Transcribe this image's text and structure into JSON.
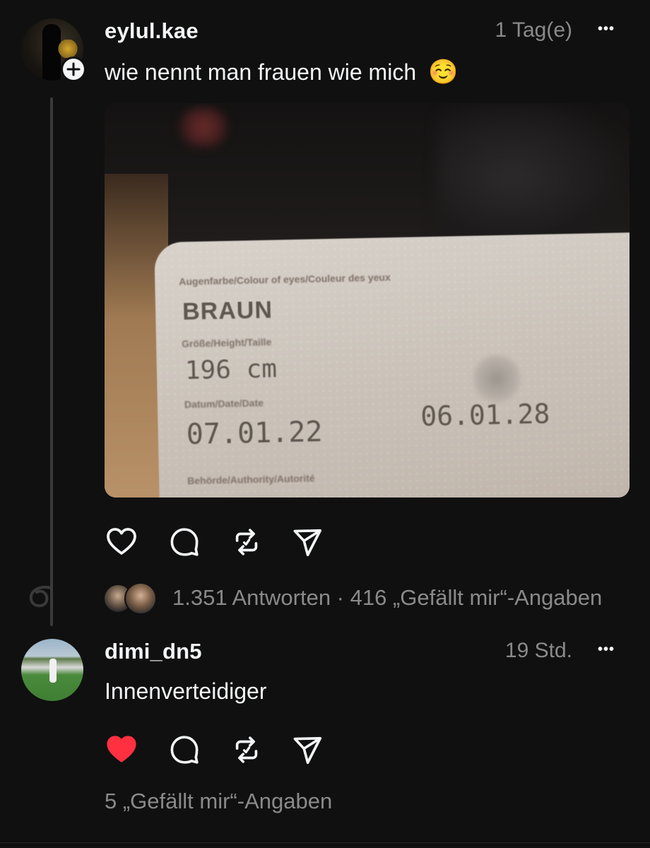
{
  "post": {
    "username": "eylul.kae",
    "time": "1 Tag(e)",
    "more": "•••",
    "text": "wie nennt man frauen wie mich",
    "emoji": "☺️",
    "image": {
      "eye_label": "Augenfarbe/Colour of eyes/Couleur des yeux",
      "eye_value": "BRAUN",
      "height_label": "Größe/Height/Taille",
      "height_value": "196 cm",
      "date_label": "Datum/Date/Date",
      "date_value": "07.01.22",
      "expiry_value": "06.01.28",
      "authority_label": "Behörde/Authority/Autorité"
    },
    "stats": "1.351 Antworten · 416 „Gefällt mir“-Angaben",
    "liked": false
  },
  "reply": {
    "username": "dimi_dn5",
    "time": "19 Std.",
    "more": "•••",
    "text": "Innenverteidiger",
    "stats": "5 „Gefällt mir“-Angaben",
    "liked": true
  },
  "colors": {
    "background": "#101010",
    "text": "#f3f5f7",
    "secondary": "#8a8a8a",
    "like_red": "#ff3040"
  },
  "icons": [
    "heart-icon",
    "comment-icon",
    "repost-icon",
    "share-icon",
    "plus-icon",
    "more-icon"
  ]
}
